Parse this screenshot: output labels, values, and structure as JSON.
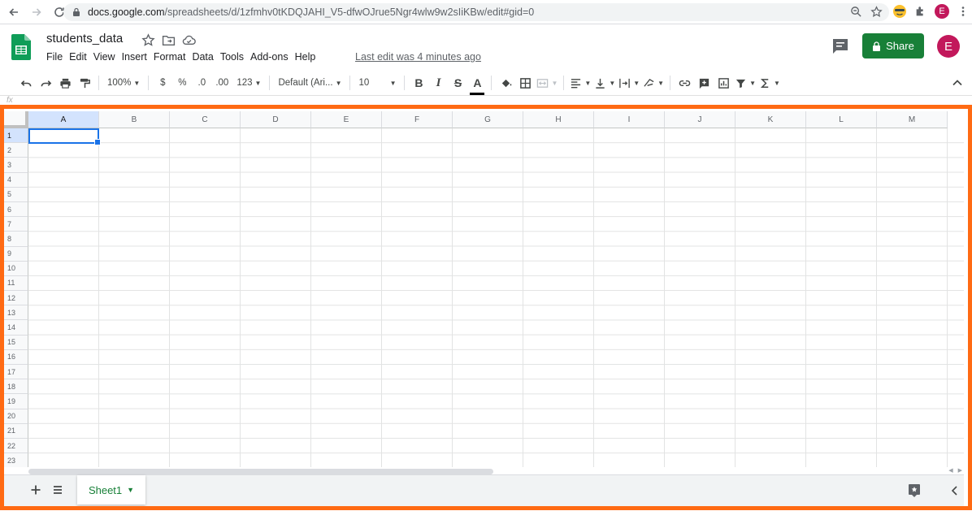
{
  "browser": {
    "url_host": "docs.google.com",
    "url_path": "/spreadsheets/d/1zfmhv0tKDQJAHI_V5-dfwOJrue5Ngr4wlw9w2sIiKBw/edit#gid=0",
    "profile_initial": "E"
  },
  "doc": {
    "title": "students_data",
    "menu": [
      "File",
      "Edit",
      "View",
      "Insert",
      "Format",
      "Data",
      "Tools",
      "Add-ons",
      "Help"
    ],
    "last_edit": "Last edit was 4 minutes ago",
    "share_label": "Share",
    "avatar_initial": "E"
  },
  "toolbar": {
    "zoom": "100%",
    "currency": "$",
    "percent": "%",
    "dec_decrease": ".0",
    "dec_increase": ".00",
    "more_formats": "123",
    "font": "Default (Ari...",
    "font_size": "10",
    "bold": "B",
    "italic": "I",
    "strike": "S",
    "text_color": "A"
  },
  "formula": {
    "fx": "fx"
  },
  "grid": {
    "columns": [
      "A",
      "B",
      "C",
      "D",
      "E",
      "F",
      "G",
      "H",
      "I",
      "J",
      "K",
      "L",
      "M"
    ],
    "rows": [
      "1",
      "2",
      "3",
      "4",
      "5",
      "6",
      "7",
      "8",
      "9",
      "10",
      "11",
      "12",
      "13",
      "14",
      "15",
      "16",
      "17",
      "18",
      "19",
      "20",
      "21",
      "22",
      "23"
    ],
    "selected_cell": "A1"
  },
  "sheets": {
    "tabs": [
      "Sheet1"
    ],
    "active": "Sheet1"
  },
  "colors": {
    "accent": "#188038",
    "selection": "#1a73e8",
    "highlight_frame": "#ff6a13",
    "avatar": "#c2185b"
  }
}
